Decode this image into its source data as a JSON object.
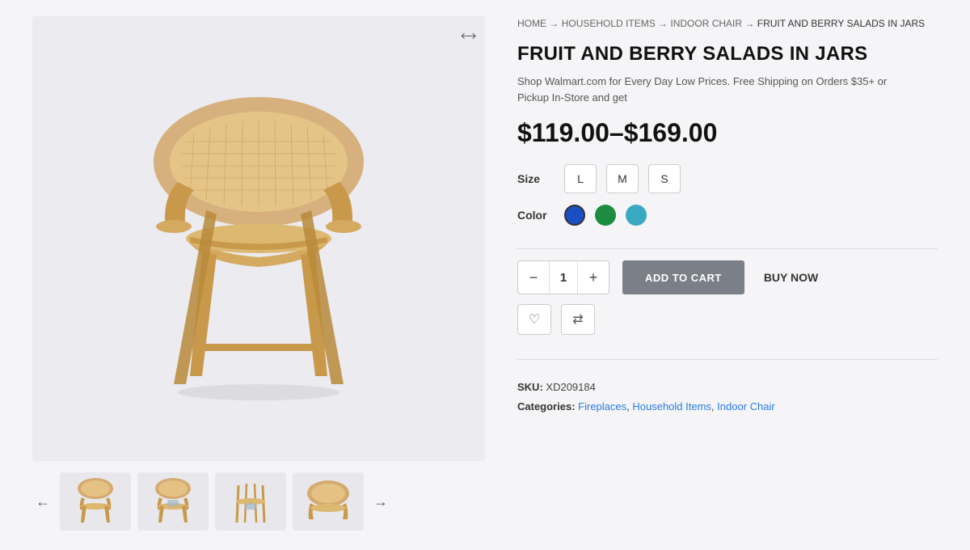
{
  "breadcrumb": {
    "home": "HOME",
    "arrow1": "→",
    "cat1": "HOUSEHOLD ITEMS",
    "arrow2": "→",
    "cat2": "INDOOR CHAIR",
    "arrow3": "→",
    "current": "FRUIT AND BERRY SALADS IN JARS"
  },
  "product": {
    "title": "FRUIT AND BERRY SALADS IN JARS",
    "description": "Shop Walmart.com for Every Day Low Prices. Free Shipping on Orders $35+ or Pickup In-Store and get",
    "price_range": "$119.00–$169.00",
    "size_label": "Size",
    "sizes": [
      "L",
      "M",
      "S"
    ],
    "color_label": "Color",
    "colors": [
      "#1a4fc4",
      "#1e8c40",
      "#3aa8c1"
    ],
    "quantity": "1",
    "add_to_cart": "ADD TO CART",
    "buy_now": "BUY NOW",
    "sku_label": "SKU:",
    "sku_value": "XD209184",
    "categories_label": "Categories:",
    "categories": "Fireplaces, Household Items, Indoor Chair",
    "category_links": [
      "Fireplaces",
      "Household Items",
      "Indoor Chair"
    ]
  },
  "expand_symbol": "⤢",
  "icons": {
    "minus": "−",
    "plus": "+",
    "heart": "♡",
    "refresh": "⇄",
    "arrow_left": "←",
    "arrow_right": "→"
  }
}
